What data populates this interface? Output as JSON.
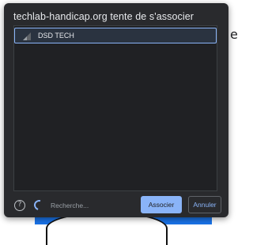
{
  "dialog": {
    "title": "techlab-handicap.org tente de s'associer",
    "devices": [
      {
        "name": "DSD TECH",
        "icon": "signal-strength-icon"
      }
    ],
    "status": "Recherche...",
    "buttons": {
      "pair": "Associer",
      "cancel": "Annuler"
    }
  },
  "background": {
    "partial_text": "e"
  },
  "colors": {
    "dialog_bg": "#292a2d",
    "accent": "#8ab4f8",
    "list_bg": "#202124",
    "page_blue": "#1a73e8"
  }
}
